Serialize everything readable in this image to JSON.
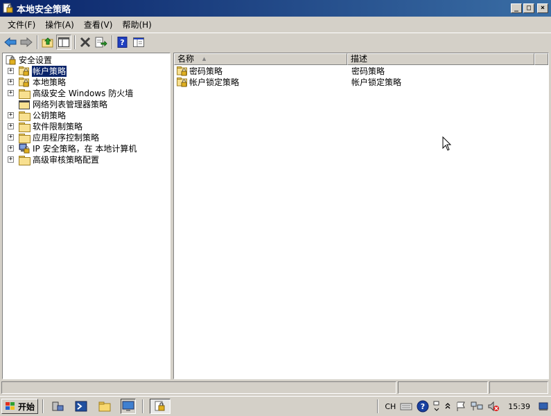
{
  "window": {
    "title": "本地安全策略",
    "min_label": "_",
    "max_label": "□",
    "close_label": "×"
  },
  "menu": [
    {
      "label": "文件(F)"
    },
    {
      "label": "操作(A)"
    },
    {
      "label": "查看(V)"
    },
    {
      "label": "帮助(H)"
    }
  ],
  "toolbar": {
    "buttons": [
      "back-icon",
      "forward-icon",
      "up-folder-icon",
      "show-hide-tree-icon",
      "delete-icon",
      "export-list-icon",
      "help-icon",
      "properties-icon"
    ]
  },
  "tree": {
    "root_label": "安全设置",
    "items": [
      {
        "label": "帐户策略",
        "expander": "+",
        "icon": "folder-lock-icon",
        "selected": true
      },
      {
        "label": "本地策略",
        "expander": "+",
        "icon": "folder-lock-icon"
      },
      {
        "label": "高级安全 Windows 防火墙",
        "expander": "+",
        "icon": "folder-icon"
      },
      {
        "label": "网络列表管理器策略",
        "expander": "",
        "icon": "folder-icon"
      },
      {
        "label": "公钥策略",
        "expander": "+",
        "icon": "folder-icon"
      },
      {
        "label": "软件限制策略",
        "expander": "+",
        "icon": "folder-icon"
      },
      {
        "label": "应用程序控制策略",
        "expander": "+",
        "icon": "folder-icon"
      },
      {
        "label": "IP 安全策略，在 本地计算机",
        "expander": "+",
        "icon": "ipsec-icon"
      },
      {
        "label": "高级审核策略配置",
        "expander": "+",
        "icon": "folder-icon"
      }
    ]
  },
  "list": {
    "columns": [
      {
        "label": "名称",
        "sort": "▲"
      },
      {
        "label": "描述"
      }
    ],
    "rows": [
      {
        "name": "密码策略",
        "description": "密码策略"
      },
      {
        "name": "帐户锁定策略",
        "description": "帐户锁定策略"
      }
    ]
  },
  "taskbar": {
    "start_label": "开始",
    "language": "CH",
    "clock": "15:39"
  },
  "colors": {
    "title_start": "#0a246a",
    "title_end": "#3a6ea5",
    "selection": "#0a246a",
    "chrome": "#d4d0c8"
  }
}
